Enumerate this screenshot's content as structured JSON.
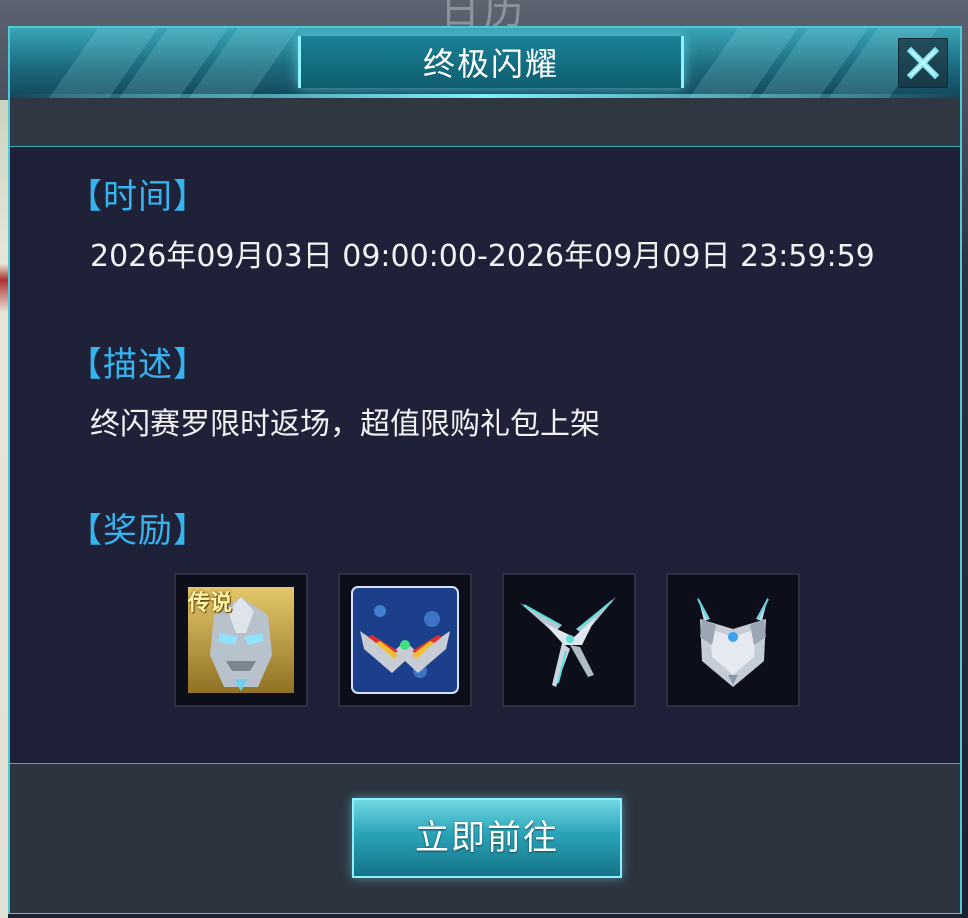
{
  "background": {
    "title": "日历"
  },
  "dialog": {
    "title": "终极闪耀",
    "close_icon": "close-x-icon"
  },
  "time_section": {
    "heading": "【时间】",
    "value": "2026年09月03日 09:00:00-2026年09月09日 23:59:59"
  },
  "description_section": {
    "heading": "【描述】",
    "value": "终闪赛罗限时返场，超值限购礼包上架"
  },
  "rewards_section": {
    "heading": "【奖励】",
    "items": [
      {
        "icon": "zero-hero-portrait-icon",
        "badge": "传说"
      },
      {
        "icon": "zero-eye-visor-icon"
      },
      {
        "icon": "crystal-blades-icon"
      },
      {
        "icon": "silver-armor-crest-icon"
      }
    ]
  },
  "footer": {
    "go_button_label": "立即前往"
  },
  "colors": {
    "accent_cyan": "#4ec7d6",
    "heading_blue": "#35b4ee",
    "panel_bg": "#1e2138"
  }
}
